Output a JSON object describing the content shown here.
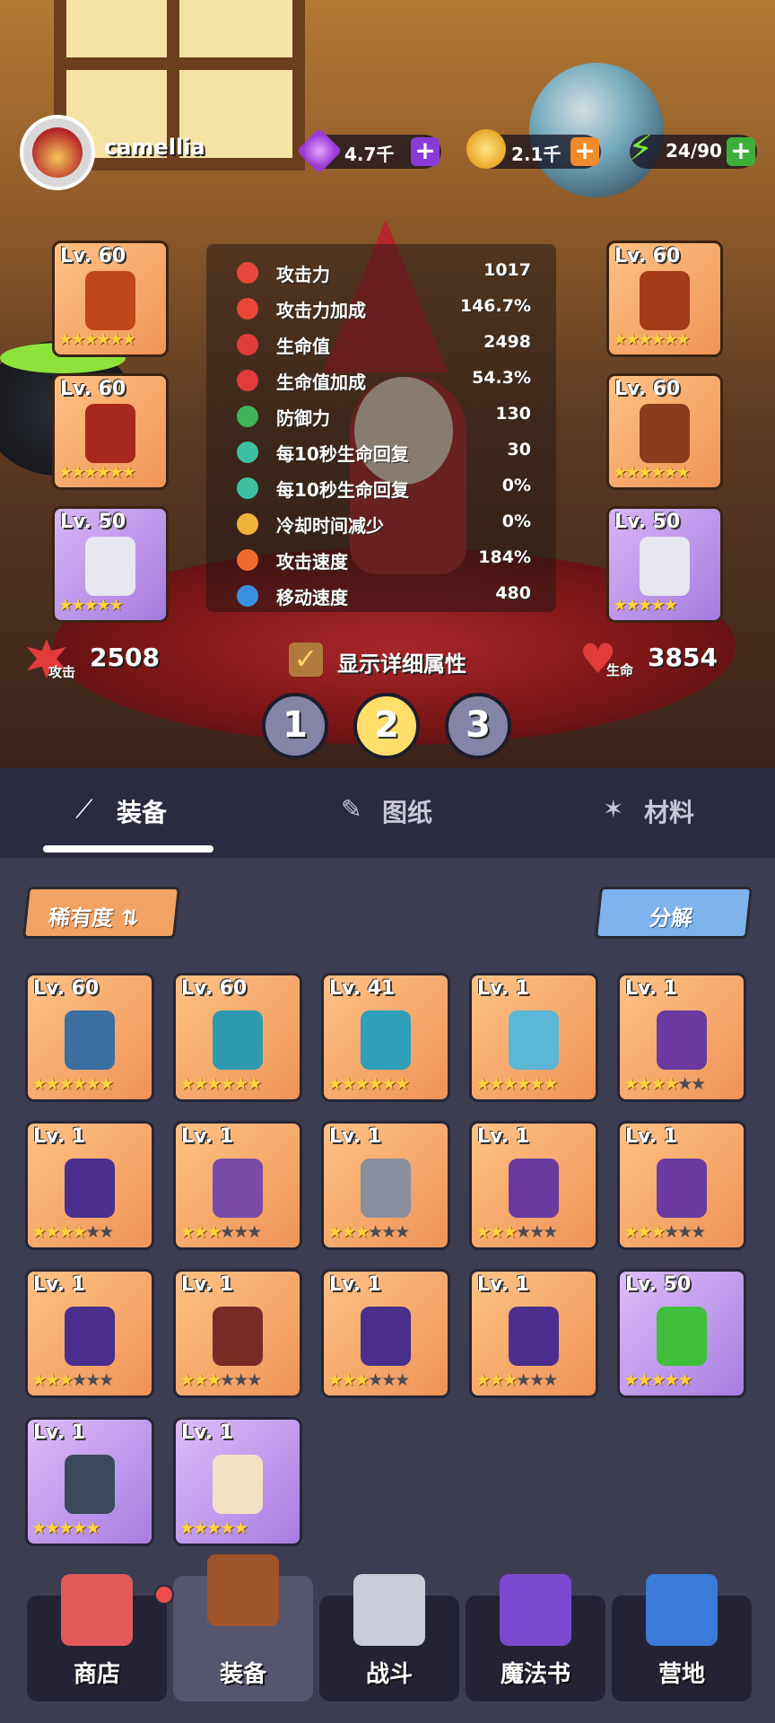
{
  "player": {
    "name": "camellia"
  },
  "resources": {
    "gems": {
      "value": "4.7千",
      "icon": "purple-gem-icon",
      "plus_color": "#8a3ad6"
    },
    "gold": {
      "value": "2.1千",
      "icon": "gold-coin-icon",
      "plus_color": "#f08a2c"
    },
    "energy": {
      "value": "24/90",
      "icon": "lightning-icon",
      "plus_color": "#3fae3a"
    }
  },
  "equipped": [
    {
      "slot": "weapon",
      "level": "Lv. 60",
      "stars": 6,
      "max_stars": 6,
      "rarity": "orange"
    },
    {
      "slot": "boots",
      "level": "Lv. 60",
      "stars": 6,
      "max_stars": 6,
      "rarity": "orange"
    },
    {
      "slot": "necklace",
      "level": "Lv. 50",
      "stars": 5,
      "max_stars": 5,
      "rarity": "purple"
    },
    {
      "slot": "cape",
      "level": "Lv. 60",
      "stars": 6,
      "max_stars": 6,
      "rarity": "orange"
    },
    {
      "slot": "shoes",
      "level": "Lv. 60",
      "stars": 6,
      "max_stars": 6,
      "rarity": "orange"
    },
    {
      "slot": "necklace",
      "level": "Lv. 50",
      "stars": 5,
      "max_stars": 5,
      "rarity": "purple"
    }
  ],
  "stats": [
    {
      "label": "攻击力",
      "value": "1017",
      "icon": "attack-icon",
      "color": "#e8473a"
    },
    {
      "label": "攻击力加成",
      "value": "146.7%",
      "icon": "attack-bonus-icon",
      "color": "#e8473a"
    },
    {
      "label": "生命值",
      "value": "2498",
      "icon": "heart-icon",
      "color": "#e23b3b"
    },
    {
      "label": "生命值加成",
      "value": "54.3%",
      "icon": "heart-plus-icon",
      "color": "#e23b3b"
    },
    {
      "label": "防御力",
      "value": "130",
      "icon": "shield-icon",
      "color": "#3fb25a"
    },
    {
      "label": "每10秒生命回复",
      "value": "30",
      "icon": "regen-icon",
      "color": "#3dc0a0"
    },
    {
      "label": "每10秒生命回复",
      "value": "0%",
      "icon": "regen-plus-icon",
      "color": "#3dc0a0"
    },
    {
      "label": "冷却时间减少",
      "value": "0%",
      "icon": "stopwatch-icon",
      "color": "#f2b33a"
    },
    {
      "label": "攻击速度",
      "value": "184%",
      "icon": "flame-icon",
      "color": "#ef6a2e"
    },
    {
      "label": "移动速度",
      "value": "480",
      "icon": "boot-arrow-icon",
      "color": "#3a8fe0"
    }
  ],
  "summary": {
    "attack_label": "攻击",
    "attack_value": "2508",
    "detail_label": "显示详细属性",
    "hp_label": "生命",
    "hp_value": "3854"
  },
  "presets": [
    {
      "label": "1",
      "active": false
    },
    {
      "label": "2",
      "active": true
    },
    {
      "label": "3",
      "active": false
    }
  ],
  "tabs": [
    {
      "label": "装备",
      "icon": "wand-icon",
      "active": true
    },
    {
      "label": "图纸",
      "icon": "scroll-icon",
      "active": false
    },
    {
      "label": "材料",
      "icon": "sparkle-icon",
      "active": false
    }
  ],
  "toolbar": {
    "sort_label": "稀有度 ⇅",
    "decompose_label": "分解"
  },
  "inventory": [
    {
      "level": "Lv. 60",
      "stars": 6,
      "max_stars": 6,
      "rarity": "orange",
      "item": "crystal-staff",
      "color": "#3b6fa0"
    },
    {
      "level": "Lv. 60",
      "stars": 6,
      "max_stars": 6,
      "rarity": "orange",
      "item": "teal-bracers",
      "color": "#2e9ab0"
    },
    {
      "level": "Lv. 41",
      "stars": 6,
      "max_stars": 6,
      "rarity": "orange",
      "item": "teal-cape",
      "color": "#2fa0b8"
    },
    {
      "level": "Lv. 1",
      "stars": 6,
      "max_stars": 6,
      "rarity": "orange",
      "item": "teal-boots",
      "color": "#5ab7d6"
    },
    {
      "level": "Lv. 1",
      "stars": 4,
      "max_stars": 6,
      "rarity": "orange",
      "item": "purple-cape",
      "color": "#6a3aa0"
    },
    {
      "level": "Lv. 1",
      "stars": 4,
      "max_stars": 6,
      "rarity": "orange",
      "item": "purple-boots",
      "color": "#4a2f8f"
    },
    {
      "level": "Lv. 1",
      "stars": 3,
      "max_stars": 6,
      "rarity": "orange",
      "item": "purple-staff",
      "color": "#7a4aa8"
    },
    {
      "level": "Lv. 1",
      "stars": 3,
      "max_stars": 6,
      "rarity": "orange",
      "item": "silver-staff",
      "color": "#8a8fa0"
    },
    {
      "level": "Lv. 1",
      "stars": 3,
      "max_stars": 6,
      "rarity": "orange",
      "item": "purple-cape",
      "color": "#6a3aa0"
    },
    {
      "level": "Lv. 1",
      "stars": 3,
      "max_stars": 6,
      "rarity": "orange",
      "item": "purple-cape",
      "color": "#6a3aa0"
    },
    {
      "level": "Lv. 1",
      "stars": 3,
      "max_stars": 6,
      "rarity": "orange",
      "item": "purple-bracers",
      "color": "#4a2f8f"
    },
    {
      "level": "Lv. 1",
      "stars": 3,
      "max_stars": 6,
      "rarity": "orange",
      "item": "red-boots",
      "color": "#7a2a24"
    },
    {
      "level": "Lv. 1",
      "stars": 3,
      "max_stars": 6,
      "rarity": "orange",
      "item": "purple-boots",
      "color": "#4a2f8f"
    },
    {
      "level": "Lv. 1",
      "stars": 3,
      "max_stars": 6,
      "rarity": "orange",
      "item": "purple-boots",
      "color": "#4a2f8f"
    },
    {
      "level": "Lv. 50",
      "stars": 5,
      "max_stars": 5,
      "rarity": "purple",
      "item": "green-ring",
      "color": "#3fbf3a"
    },
    {
      "level": "Lv. 1",
      "stars": 5,
      "max_stars": 5,
      "rarity": "purple",
      "item": "rune-stone",
      "color": "#3a4a5a"
    },
    {
      "level": "Lv. 1",
      "stars": 5,
      "max_stars": 5,
      "rarity": "purple",
      "item": "seashell",
      "color": "#f1e2c4"
    }
  ],
  "nav": [
    {
      "label": "商店",
      "icon": "shop-icon",
      "color": "#e25a5a",
      "active": false,
      "notification": true
    },
    {
      "label": "装备",
      "icon": "backpack-icon",
      "color": "#a0542a",
      "active": true,
      "notification": false
    },
    {
      "label": "战斗",
      "icon": "crossed-swords-icon",
      "color": "#c8ccd6",
      "active": false,
      "notification": false
    },
    {
      "label": "魔法书",
      "icon": "spellbook-icon",
      "color": "#7a4ad0",
      "active": false,
      "notification": false
    },
    {
      "label": "营地",
      "icon": "crown-shield-icon",
      "color": "#3a7ad8",
      "active": false,
      "notification": false
    }
  ]
}
